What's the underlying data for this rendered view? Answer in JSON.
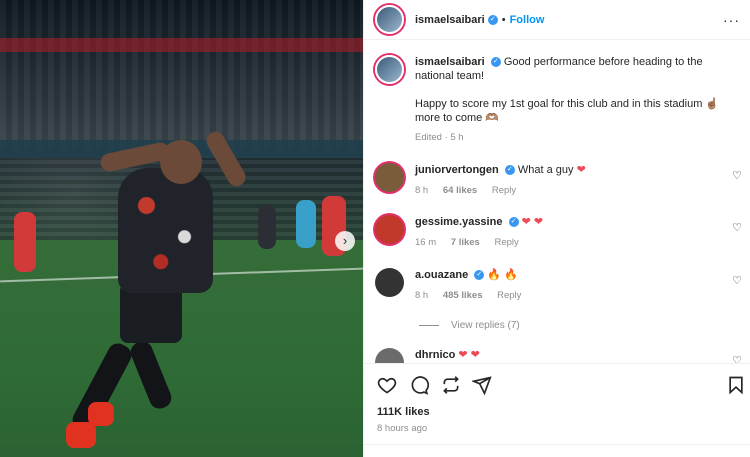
{
  "post": {
    "username": "ismaelsaibari",
    "follow_label": "Follow",
    "dot": "•",
    "more": "···",
    "media_next": "›"
  },
  "caption": {
    "username": "ismaelsaibari",
    "line1": "Good performance before heading to the national team!",
    "line2": "Happy to score my 1st goal for this club and in this stadium",
    "line2_emoji": "☝🏽",
    "line3": "more to come",
    "line3_emoji": "🫶🏽",
    "meta": "Edited · 5 h"
  },
  "comments": [
    {
      "username": "juniorvertongen",
      "text": "What a guy",
      "emoji": "❤",
      "time": "8 h",
      "likes": "64 likes",
      "reply": "Reply",
      "avatar_color": "#7a5c3a"
    },
    {
      "username": "gessime.yassine",
      "text": "",
      "emoji": "❤ ❤",
      "time": "16 m",
      "likes": "7 likes",
      "reply": "Reply",
      "avatar_color": "#c0392b"
    },
    {
      "username": "a.ouazane",
      "text": "",
      "emoji": "🔥 🔥",
      "time": "8 h",
      "likes": "485 likes",
      "reply": "Reply",
      "avatar_color": "#333333"
    },
    {
      "username": "dhrnico",
      "text": "",
      "emoji": "❤ ❤",
      "time": "",
      "likes": "",
      "reply": "",
      "avatar_color": "#6b6b6b"
    }
  ],
  "view_replies": "View replies (7)",
  "stats": {
    "likes": "111K likes",
    "posted": "8 hours ago"
  },
  "colors": {
    "accent": "#0095f6",
    "verified": "#3897f0",
    "heart": "#ed4956",
    "muted": "#8e8e8e"
  },
  "icons": [
    "heart-icon",
    "comment-icon",
    "repost-icon",
    "share-icon",
    "bookmark-icon",
    "verified-badge-icon",
    "like-comment-icon"
  ]
}
